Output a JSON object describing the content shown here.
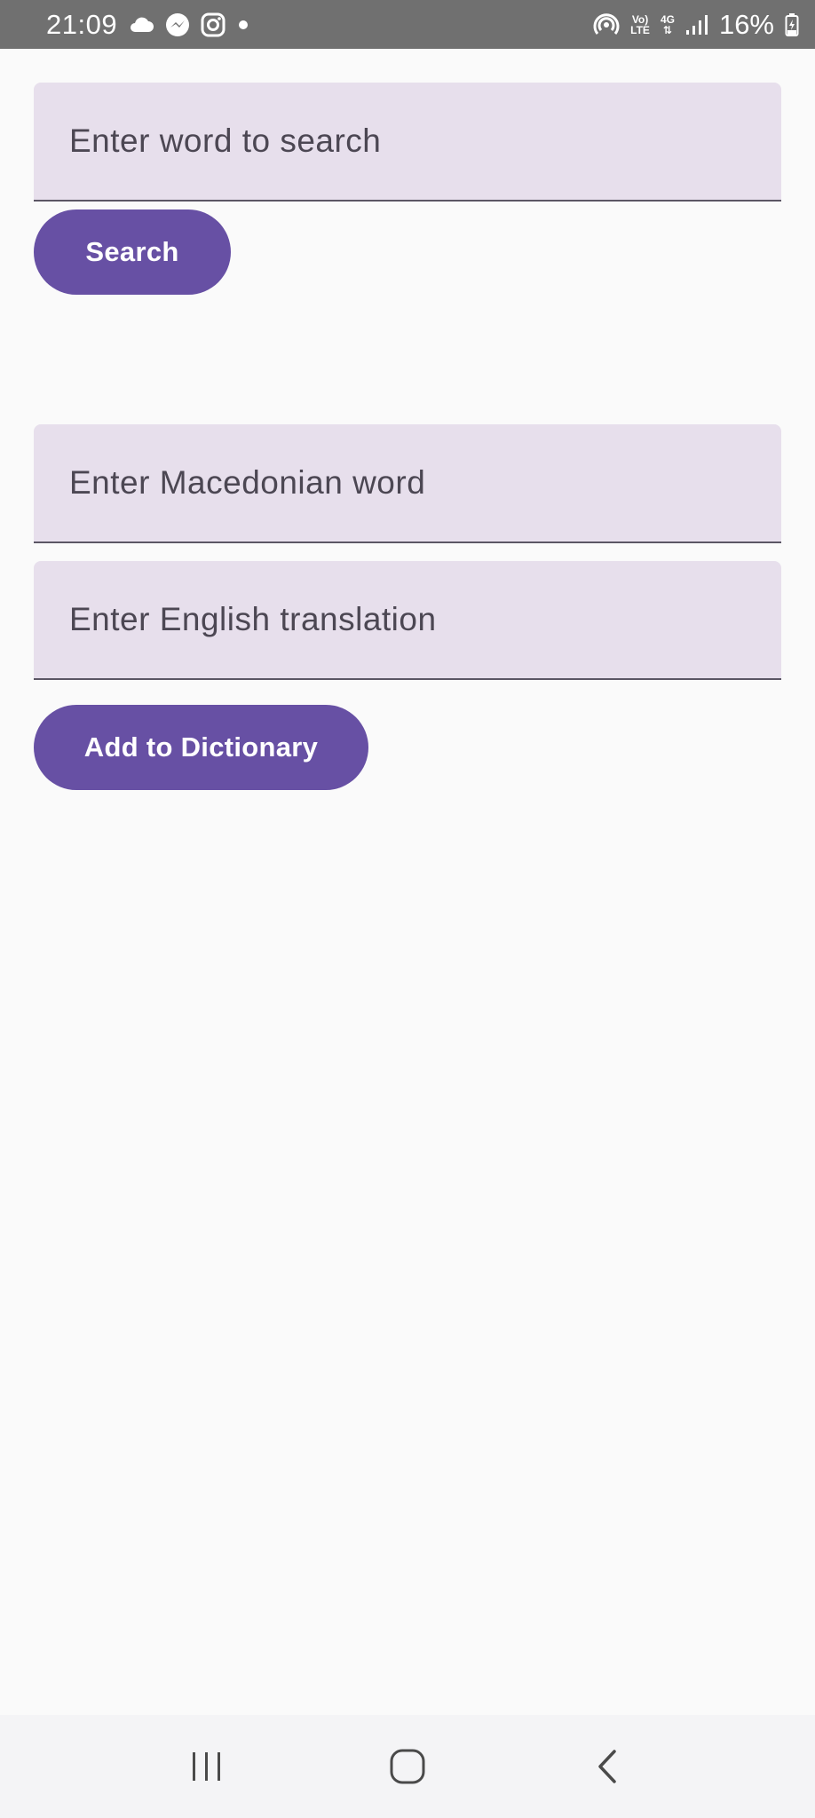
{
  "status_bar": {
    "time": "21:09",
    "left_icons": [
      "cloud-icon",
      "messenger-icon",
      "instagram-icon",
      "notification-dot-icon"
    ],
    "network_top": "Vo)",
    "network_bottom": "LTE",
    "data_top": "4G",
    "battery": "16%",
    "right_icons": [
      "hotspot-icon",
      "volte-icon",
      "data-4g-icon",
      "signal-icon",
      "battery-icon"
    ]
  },
  "search": {
    "placeholder": "Enter word to search",
    "value": "",
    "button_label": "Search"
  },
  "add_entry": {
    "macedonian_placeholder": "Enter Macedonian word",
    "macedonian_value": "",
    "english_placeholder": "Enter English translation",
    "english_value": "",
    "button_label": "Add to Dictionary"
  },
  "navigation": {
    "items": [
      "recent-apps-icon",
      "home-icon",
      "back-icon"
    ]
  },
  "colors": {
    "primary": "#6750a4",
    "field_background": "#e7dfec",
    "background": "#fafafa",
    "status_bar": "#707070"
  }
}
